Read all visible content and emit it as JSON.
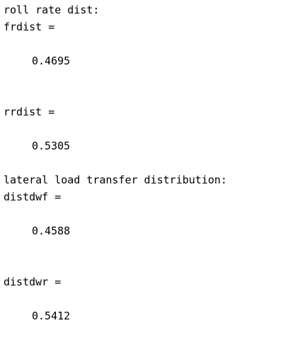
{
  "console": {
    "lines": {
      "roll_rate_header": "roll rate dist:",
      "frdist_label": "frdist =",
      "frdist_value": "0.4695",
      "rrdist_label": "rrdist =",
      "rrdist_value": "0.5305",
      "lateral_header": "lateral load transfer distribution:",
      "distdwf_label": "distdwf =",
      "distdwf_value": "0.4588",
      "distdwr_label": "distdwr =",
      "distdwr_value": "0.5412"
    }
  }
}
